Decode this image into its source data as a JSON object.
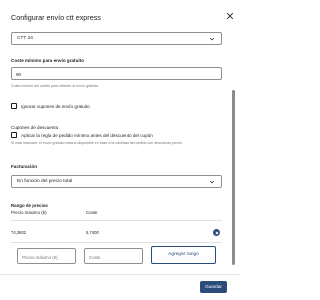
{
  "dialog": {
    "title": "Configurar envío ctt express",
    "save_label": "Guardar"
  },
  "service_select": {
    "value": "CTT 24"
  },
  "min_cost": {
    "label": "Coste mínimo para envío gratuito",
    "value": "90",
    "help": "Coste mínimo del carrito para obtener el envío gratuito."
  },
  "ignore_coupons": {
    "label": "Ignorar cupones de envío gratuito"
  },
  "discount_coupons": {
    "heading": "Cupones de descuento",
    "checkbox_label": "Aplicar la regla de pedido mínimo antes del descuento del cupón",
    "help": "Si está marcado, el envío gratuito estaría disponible en base a la cantidad del pedido con descuento previo."
  },
  "billing": {
    "label": "Facturación",
    "value": "En función del precio total"
  },
  "price_range": {
    "heading": "Rango de precios",
    "columns": [
      "Precio máximo (€)",
      "Coste"
    ],
    "rows": [
      {
        "max_price": "74,3802",
        "cost": "5,7400"
      }
    ],
    "max_price_placeholder": "Precio máximo (€)",
    "cost_placeholder": "Coste",
    "add_label": "Agregar rango"
  },
  "colors": {
    "primary": "#2a4b7c",
    "text": "#1e1e1e",
    "muted": "#757575"
  }
}
